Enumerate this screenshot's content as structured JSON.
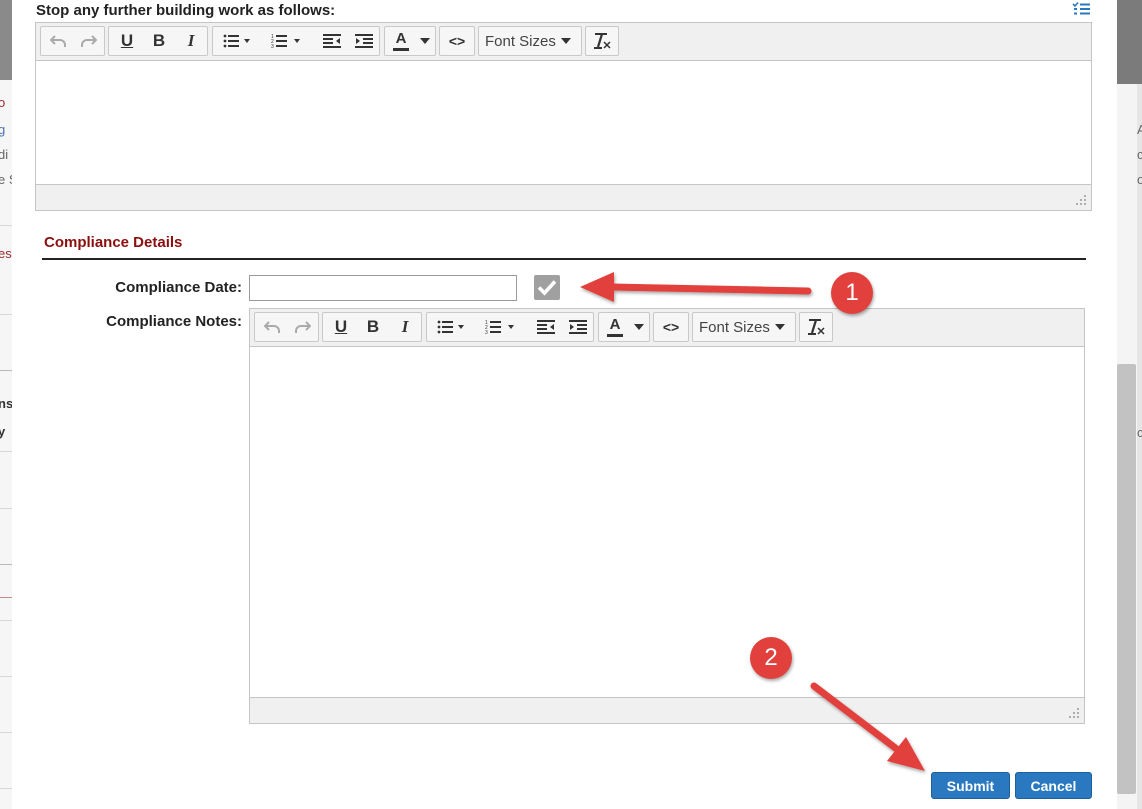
{
  "background_page": {
    "left_fragments": [
      "o",
      "g",
      "di",
      "e S",
      "es",
      "ns",
      "y"
    ],
    "right_fragments": [
      "A",
      "c",
      "o",
      "c"
    ]
  },
  "stop_work": {
    "title": "Stop any further building work as follows:",
    "list_icon": "checklist-icon"
  },
  "toolbar": {
    "undo_icon": "undo-icon",
    "redo_icon": "redo-icon",
    "underline": "U",
    "bold": "B",
    "italic": "I",
    "bullet_list_icon": "bullet-list-icon",
    "numbered_list_icon": "numbered-list-icon",
    "outdent_icon": "outdent-icon",
    "indent_icon": "indent-icon",
    "text_color": "A",
    "code": "<>",
    "font_sizes": "Font Sizes",
    "clear_format_icon": "clear-formatting-icon"
  },
  "compliance": {
    "title": "Compliance Details",
    "date_label": "Compliance Date:",
    "date_value": "",
    "date_placeholder": "",
    "notes_label": "Compliance Notes:"
  },
  "actions": {
    "submit": "Submit",
    "cancel": "Cancel"
  },
  "annotations": {
    "badge_1": "1",
    "badge_2": "2",
    "color": "#e2403c"
  },
  "colors": {
    "accent_blue": "#2a79c0",
    "section_red": "#8b0f0f"
  }
}
